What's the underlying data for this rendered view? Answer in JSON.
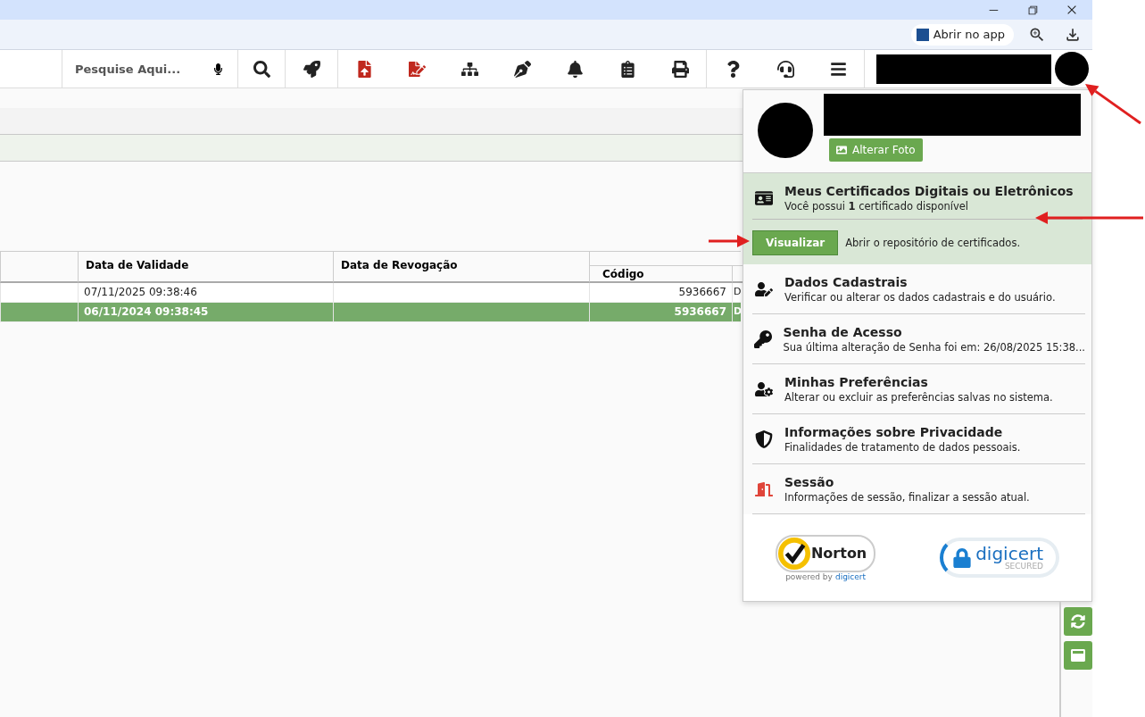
{
  "browser": {
    "open_in_app": "Abrir no app"
  },
  "toolbar": {
    "search": {
      "placeholder": "Pesquise Aqui..."
    }
  },
  "table": {
    "columns": [
      "Data de Validade",
      "Data de Revogação",
      "Código"
    ],
    "rows": [
      {
        "validade": "07/11/2025 09:38:46",
        "codigo": "5936667",
        "column_5": "D",
        "selected": false
      },
      {
        "validade": "06/11/2024 09:38:45",
        "codigo": "5936667",
        "column_5": "D",
        "selected": true
      }
    ]
  },
  "user_menu": {
    "change_photo": "Alterar Foto",
    "certificates": {
      "title": "Meus Certificados Digitais ou Eletrônicos",
      "subtitle": "Você possui **1** certificado disponível",
      "button": "Visualizar",
      "hint": "Abrir o repositório de certificados."
    },
    "items": [
      {
        "title": "Dados Cadastrais",
        "subtitle": "Verificar ou alterar os dados cadastrais e do usuário."
      },
      {
        "title": "Senha de Acesso",
        "subtitle": "Sua última alteração de Senha foi em: 26/08/2025 15:38..."
      },
      {
        "title": "Minhas Preferências",
        "subtitle": "Alterar ou excluir as preferências salvas no sistema."
      },
      {
        "title": "Informações sobre Privacidade",
        "subtitle": "Finalidades de tratamento de dados pessoais."
      },
      {
        "title": "Sessão",
        "subtitle": "Informações de sessão, finalizar a sessão atual."
      }
    ],
    "seals": {
      "norton": "Norton",
      "norton_powered": "powered by",
      "norton_brand": "digicert",
      "digicert": "digicert",
      "digicert_sub": "SECURED"
    }
  }
}
